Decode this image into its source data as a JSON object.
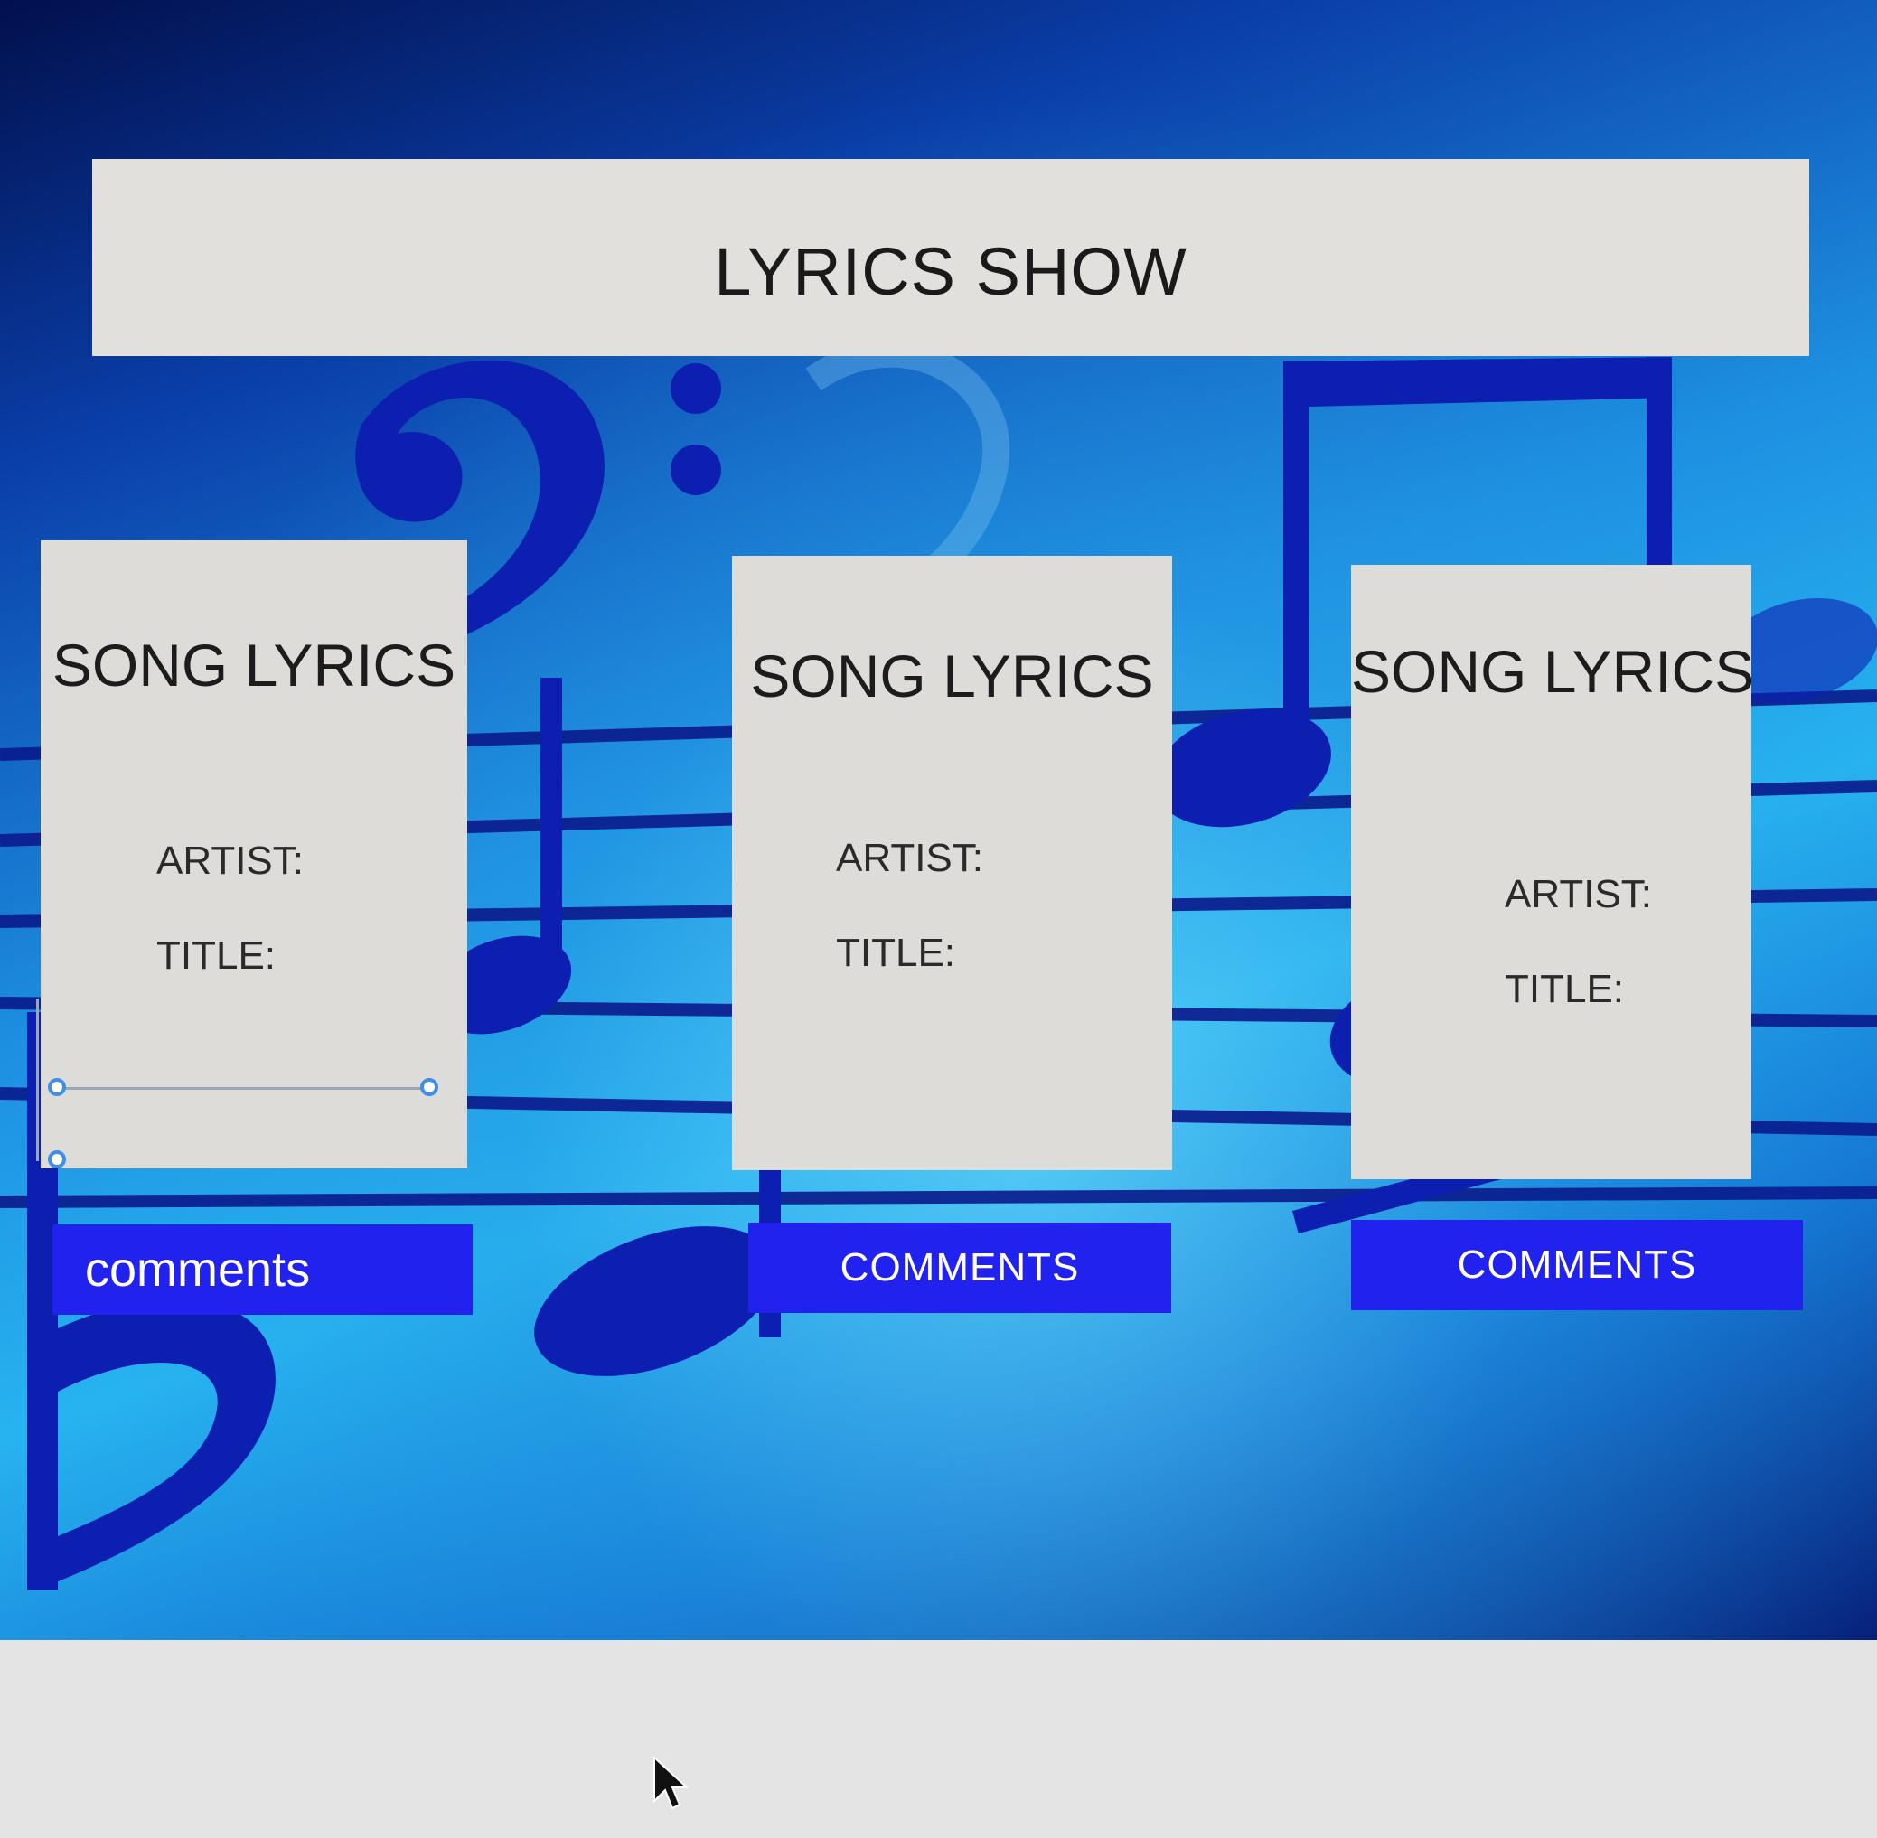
{
  "header": {
    "title": "LYRICS SHOW"
  },
  "cards": [
    {
      "title": "SONG LYRICS",
      "artist_label": "ARTIST:",
      "title_label": "TITLE:",
      "button_label": "comments"
    },
    {
      "title": "SONG LYRICS",
      "artist_label": "ARTIST:",
      "title_label": "TITLE:",
      "button_label": "COMMENTS"
    },
    {
      "title": "SONG LYRICS",
      "artist_label": "ARTIST:",
      "title_label": "TITLE:",
      "button_label": "COMMENTS"
    }
  ],
  "colors": {
    "button": "#2222ee",
    "panel": "#e2e0dc",
    "note": "#0d1fb0",
    "selection_handle": "#3f8ee8"
  },
  "icons": [
    "bass-clef-icon",
    "eighth-note-icon",
    "flat-sign-icon",
    "staff-lines",
    "mouse-pointer-icon"
  ]
}
